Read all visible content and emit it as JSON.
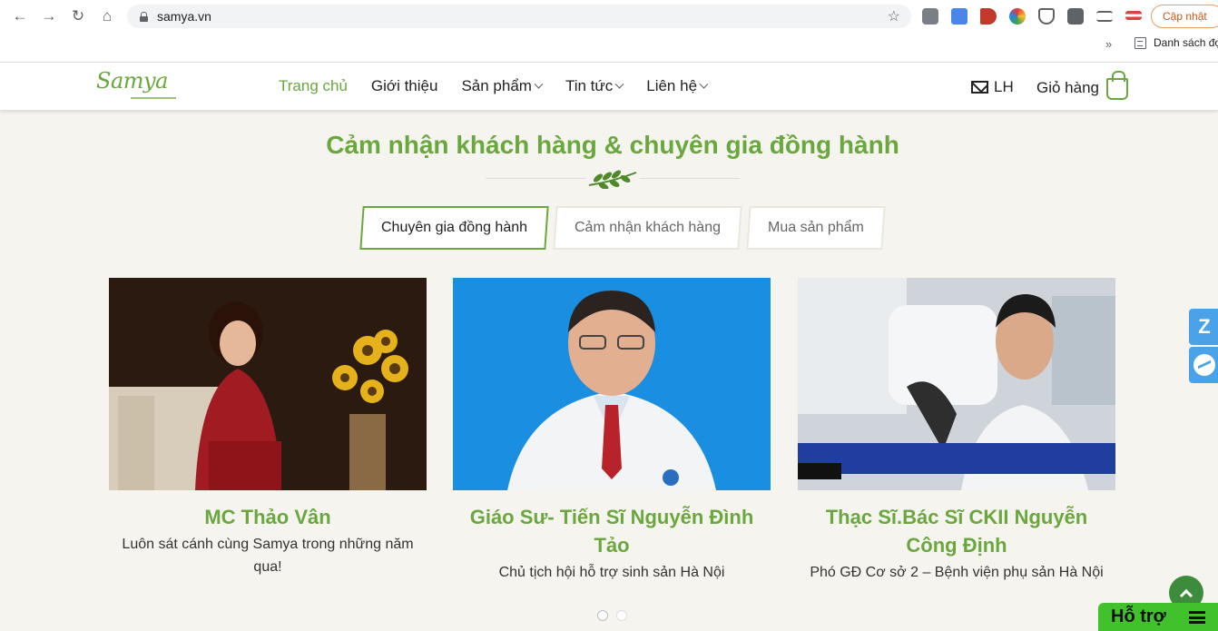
{
  "browser": {
    "url": "samya.vn",
    "update_label": "Cập nhật",
    "bookmark_label": "Danh sách đọc",
    "more_label": "»"
  },
  "header": {
    "logo_text": "Samya",
    "menu": [
      {
        "label": "Trang chủ"
      },
      {
        "label": "Giới thiệu"
      },
      {
        "label": "Sản phẩm"
      },
      {
        "label": "Tin tức"
      },
      {
        "label": "Liên hệ"
      }
    ],
    "contact_label": "LH",
    "cart_label": "Giỏ hàng"
  },
  "section": {
    "title": "Cảm nhận khách hàng & chuyên gia đồng hành",
    "tabs": [
      {
        "label": "Chuyên gia đồng hành"
      },
      {
        "label": "Cảm nhận khách hàng"
      },
      {
        "label": "Mua sản phẩm"
      }
    ],
    "cards": [
      {
        "name": "MC Thảo Vân",
        "desc": "Luôn sát cánh cùng Samya trong  những năm qua!"
      },
      {
        "name": "Giáo Sư- Tiến Sĩ Nguyễn Đình Tảo",
        "desc": "Chủ tịch hội hỗ trợ sinh sản Hà Nội"
      },
      {
        "name": "Thạc Sĩ.Bác Sĩ CKII Nguyễn Công Định",
        "desc": "Phó GĐ Cơ sở 2 – Bệnh viện phụ sản Hà Nội"
      }
    ]
  },
  "widgets": {
    "support_label": "Hỗ trợ",
    "zalo_label": "Z"
  },
  "colors": {
    "brand_green": "#6aa73e",
    "support_green": "#41c12b",
    "messenger_blue": "#4aa3e8"
  }
}
